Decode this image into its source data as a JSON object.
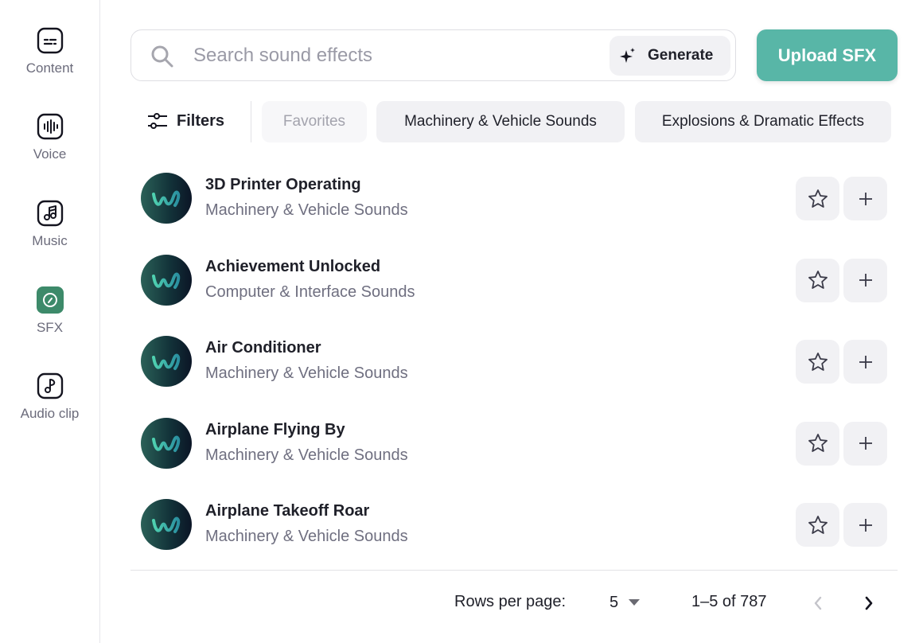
{
  "sidebar": {
    "items": [
      {
        "label": "Content",
        "icon": "subtitles-icon",
        "active": false
      },
      {
        "label": "Voice",
        "icon": "waveform-icon",
        "active": false
      },
      {
        "label": "Music",
        "icon": "music-note-icon",
        "active": false
      },
      {
        "label": "SFX",
        "icon": "sfx-dial-icon",
        "active": true
      },
      {
        "label": "Audio clip",
        "icon": "audio-clip-icon",
        "active": false
      }
    ],
    "active_color": "#3d8a6a"
  },
  "search": {
    "placeholder": "Search sound effects",
    "value": "",
    "generate_label": "Generate"
  },
  "upload": {
    "label": "Upload SFX",
    "color": "#58b6a7"
  },
  "filters": {
    "label": "Filters",
    "chips": [
      {
        "label": "Favorites",
        "disabled": true
      },
      {
        "label": "Machinery & Vehicle Sounds",
        "disabled": false
      },
      {
        "label": "Explosions & Dramatic Effects",
        "disabled": false
      }
    ]
  },
  "sounds": [
    {
      "title": "3D Printer Operating",
      "category": "Machinery & Vehicle Sounds"
    },
    {
      "title": "Achievement Unlocked",
      "category": "Computer & Interface Sounds"
    },
    {
      "title": "Air Conditioner",
      "category": "Machinery & Vehicle Sounds"
    },
    {
      "title": "Airplane Flying By",
      "category": "Machinery & Vehicle Sounds"
    },
    {
      "title": "Airplane Takeoff Roar",
      "category": "Machinery & Vehicle Sounds"
    }
  ],
  "pagination": {
    "rows_label": "Rows per page:",
    "rows_value": "5",
    "range": "1–5 of 787",
    "prev_disabled": true,
    "next_disabled": false
  }
}
